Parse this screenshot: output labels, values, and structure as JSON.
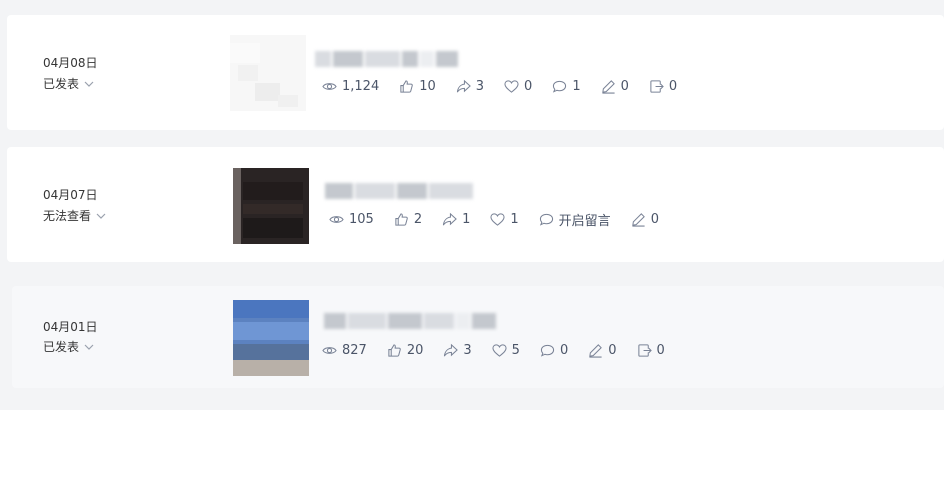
{
  "articles": [
    {
      "date": "04月08日",
      "status": "已发表",
      "thumb_style": "light",
      "stats": {
        "views": "1,124",
        "likes": "10",
        "shares": "3",
        "favs": "0",
        "comments": "1",
        "notes": "0",
        "exports": "0"
      }
    },
    {
      "date": "04月07日",
      "status": "无法查看",
      "thumb_style": "dark",
      "stats": {
        "views": "105",
        "likes": "2",
        "shares": "1",
        "favs": "1",
        "comments_label": "开启留言",
        "notes": "0"
      }
    },
    {
      "date": "04月01日",
      "status": "已发表",
      "thumb_style": "blue",
      "stats": {
        "views": "827",
        "likes": "20",
        "shares": "3",
        "favs": "5",
        "comments": "0",
        "notes": "0",
        "exports": "0"
      }
    }
  ],
  "icons": [
    "eye-icon",
    "thumbs-up-icon",
    "share-icon",
    "heart-icon",
    "comment-icon",
    "pen-icon",
    "export-icon",
    "chevron-down-icon"
  ]
}
